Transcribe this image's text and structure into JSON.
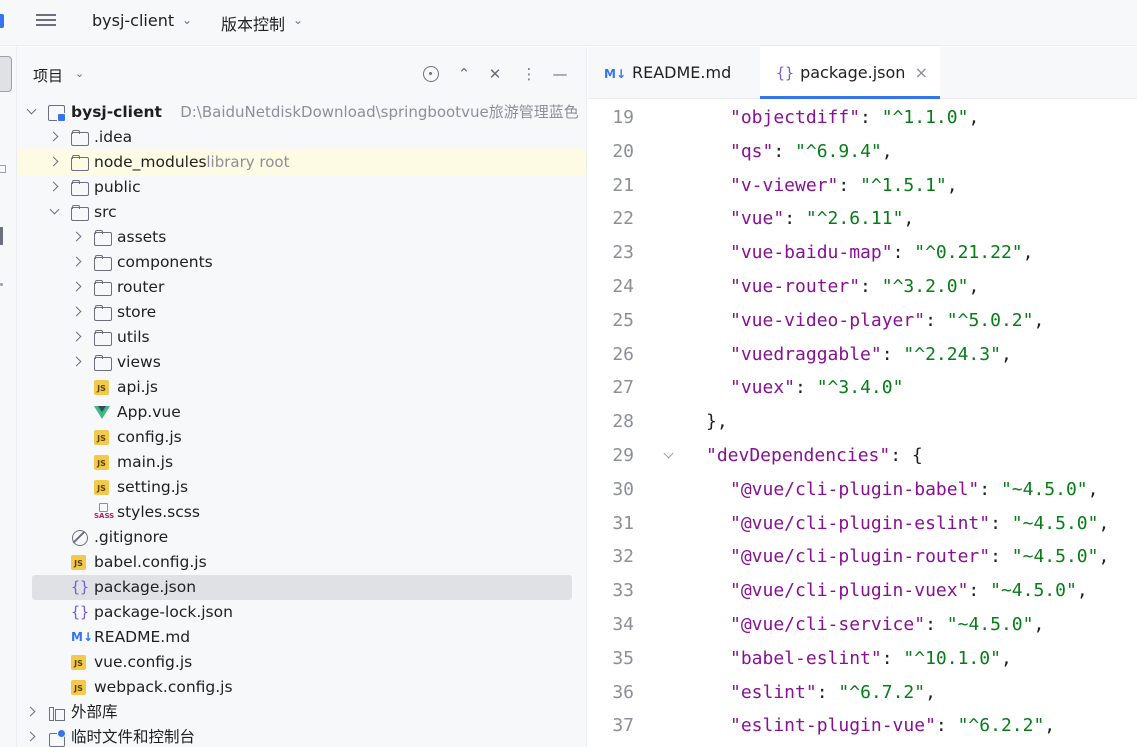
{
  "topbar": {
    "project_name": "bysj-client",
    "vcs_menu": "版本控制"
  },
  "project_panel": {
    "title": "项目",
    "tree": [
      {
        "label": "bysj-client",
        "hint": "D:\\BaiduNetdiskDownload\\springbootvue旅游管理蓝色",
        "icon": "module-icon",
        "arrow": "down",
        "level": 0,
        "bold": true
      },
      {
        "label": ".idea",
        "icon": "folder-icon",
        "arrow": "right",
        "level": 1
      },
      {
        "label": "node_modules",
        "hint": "library root",
        "icon": "folder-icon",
        "arrow": "right",
        "level": 1,
        "highlight": true
      },
      {
        "label": "public",
        "icon": "folder-icon",
        "arrow": "right",
        "level": 1
      },
      {
        "label": "src",
        "icon": "folder-icon",
        "arrow": "down",
        "level": 1
      },
      {
        "label": "assets",
        "icon": "folder-icon",
        "arrow": "right",
        "level": 2
      },
      {
        "label": "components",
        "icon": "folder-icon",
        "arrow": "right",
        "level": 2
      },
      {
        "label": "router",
        "icon": "folder-icon",
        "arrow": "right",
        "level": 2
      },
      {
        "label": "store",
        "icon": "folder-icon",
        "arrow": "right",
        "level": 2
      },
      {
        "label": "utils",
        "icon": "folder-icon",
        "arrow": "right",
        "level": 2
      },
      {
        "label": "views",
        "icon": "folder-icon",
        "arrow": "right",
        "level": 2
      },
      {
        "label": "api.js",
        "icon": "js-file-icon",
        "level": 2
      },
      {
        "label": "App.vue",
        "icon": "vue-file-icon",
        "level": 2
      },
      {
        "label": "config.js",
        "icon": "js-file-icon",
        "level": 2
      },
      {
        "label": "main.js",
        "icon": "js-file-icon",
        "level": 2
      },
      {
        "label": "setting.js",
        "icon": "js-file-icon",
        "level": 2
      },
      {
        "label": "styles.scss",
        "icon": "sass-file-icon",
        "level": 2
      },
      {
        "label": ".gitignore",
        "icon": "ignore-file-icon",
        "level": 1
      },
      {
        "label": "babel.config.js",
        "icon": "js-file-icon",
        "level": 1
      },
      {
        "label": "package.json",
        "icon": "json-file-icon",
        "level": 1,
        "selected": true
      },
      {
        "label": "package-lock.json",
        "icon": "json-file-icon",
        "level": 1
      },
      {
        "label": "README.md",
        "icon": "markdown-file-icon",
        "level": 1
      },
      {
        "label": "vue.config.js",
        "icon": "js-file-icon",
        "level": 1
      },
      {
        "label": "webpack.config.js",
        "icon": "js-file-icon",
        "level": 1
      },
      {
        "label": "外部库",
        "icon": "library-icon",
        "arrow": "right",
        "level": 0
      },
      {
        "label": "临时文件和控制台",
        "icon": "scratches-icon",
        "arrow": "right",
        "level": 0
      }
    ]
  },
  "icon_glyphs": {
    "js": "JS",
    "markdown": "M↓",
    "json": "{}",
    "sass": "SASS"
  },
  "editor": {
    "tabs": [
      {
        "label": "README.md",
        "icon": "markdown-file-icon",
        "active": false
      },
      {
        "label": "package.json",
        "icon": "json-file-icon",
        "active": true,
        "close": "×"
      }
    ],
    "lines": [
      {
        "n": "19",
        "key": "\"objectdiff\"",
        "sep": ": ",
        "val": "\"^1.1.0\"",
        "end": ",",
        "indent": 2
      },
      {
        "n": "20",
        "key": "\"qs\"",
        "sep": ": ",
        "val": "\"^6.9.4\"",
        "end": ",",
        "indent": 2
      },
      {
        "n": "21",
        "key": "\"v-viewer\"",
        "sep": ": ",
        "val": "\"^1.5.1\"",
        "end": ",",
        "indent": 2
      },
      {
        "n": "22",
        "key": "\"vue\"",
        "sep": ": ",
        "val": "\"^2.6.11\"",
        "end": ",",
        "indent": 2
      },
      {
        "n": "23",
        "key": "\"vue-baidu-map\"",
        "sep": ": ",
        "val": "\"^0.21.22\"",
        "end": ",",
        "indent": 2
      },
      {
        "n": "24",
        "key": "\"vue-router\"",
        "sep": ": ",
        "val": "\"^3.2.0\"",
        "end": ",",
        "indent": 2
      },
      {
        "n": "25",
        "key": "\"vue-video-player\"",
        "sep": ": ",
        "val": "\"^5.0.2\"",
        "end": ",",
        "indent": 2
      },
      {
        "n": "26",
        "key": "\"vuedraggable\"",
        "sep": ": ",
        "val": "\"^2.24.3\"",
        "end": ",",
        "indent": 2
      },
      {
        "n": "27",
        "key": "\"vuex\"",
        "sep": ": ",
        "val": "\"^3.4.0\"",
        "end": "",
        "indent": 2
      },
      {
        "n": "28",
        "key": "",
        "sep": "",
        "val": "",
        "end": "},",
        "indent": 1
      },
      {
        "n": "29",
        "key": "\"devDependencies\"",
        "sep": ": ",
        "val": "",
        "end": "{",
        "indent": 1,
        "fold": true
      },
      {
        "n": "30",
        "key": "\"@vue/cli-plugin-babel\"",
        "sep": ": ",
        "val": "\"~4.5.0\"",
        "end": ",",
        "indent": 2
      },
      {
        "n": "31",
        "key": "\"@vue/cli-plugin-eslint\"",
        "sep": ": ",
        "val": "\"~4.5.0\"",
        "end": ",",
        "indent": 2
      },
      {
        "n": "32",
        "key": "\"@vue/cli-plugin-router\"",
        "sep": ": ",
        "val": "\"~4.5.0\"",
        "end": ",",
        "indent": 2
      },
      {
        "n": "33",
        "key": "\"@vue/cli-plugin-vuex\"",
        "sep": ": ",
        "val": "\"~4.5.0\"",
        "end": ",",
        "indent": 2
      },
      {
        "n": "34",
        "key": "\"@vue/cli-service\"",
        "sep": ": ",
        "val": "\"~4.5.0\"",
        "end": ",",
        "indent": 2
      },
      {
        "n": "35",
        "key": "\"babel-eslint\"",
        "sep": ": ",
        "val": "\"^10.1.0\"",
        "end": ",",
        "indent": 2
      },
      {
        "n": "36",
        "key": "\"eslint\"",
        "sep": ": ",
        "val": "\"^6.7.2\"",
        "end": ",",
        "indent": 2
      },
      {
        "n": "37",
        "key": "\"eslint-plugin-vue\"",
        "sep": ": ",
        "val": "\"^6.2.2\"",
        "end": ",",
        "indent": 2
      }
    ]
  },
  "colors": {
    "accent": "#3574f0",
    "json_key": "#871094",
    "json_string": "#067d17",
    "selection": "#dfe1e5",
    "library_root_highlight": "#fdfbe3"
  }
}
